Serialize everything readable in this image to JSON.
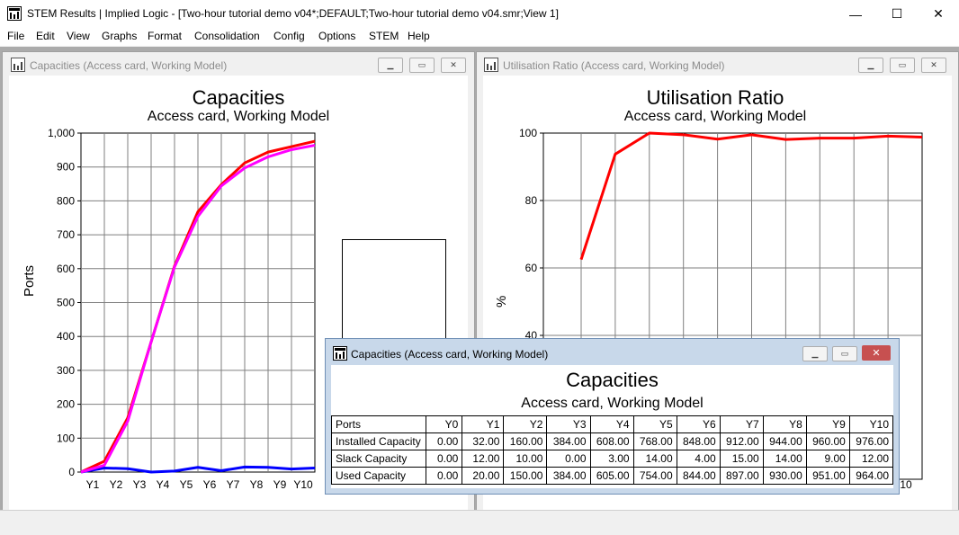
{
  "app": {
    "title": "STEM Results | Implied Logic - [Two-hour tutorial demo v04*;DEFAULT;Two-hour tutorial demo v04.smr;View 1]",
    "minimize": "—",
    "maximize": "☐",
    "close": "✕"
  },
  "menu": [
    "File",
    "Edit",
    "View",
    "Graphs",
    "Format",
    "Consolidation",
    "Config",
    "Options",
    "STEM",
    "Help"
  ],
  "left_window": {
    "title": "Capacities (Access card, Working Model)"
  },
  "right_window": {
    "title": "Utilisation Ratio (Access card, Working Model)"
  },
  "table_window": {
    "title": "Capacities (Access card, Working Model)",
    "heading": "Capacities",
    "subheading": "Access card, Working Model",
    "columns": [
      "Ports",
      "Y0",
      "Y1",
      "Y2",
      "Y3",
      "Y4",
      "Y5",
      "Y6",
      "Y7",
      "Y8",
      "Y9",
      "Y10"
    ],
    "rows": [
      {
        "label": "Installed Capacity",
        "values": [
          "0.00",
          "32.00",
          "160.00",
          "384.00",
          "608.00",
          "768.00",
          "848.00",
          "912.00",
          "944.00",
          "960.00",
          "976.00"
        ]
      },
      {
        "label": "Slack Capacity",
        "values": [
          "0.00",
          "12.00",
          "10.00",
          "0.00",
          "3.00",
          "14.00",
          "4.00",
          "15.00",
          "14.00",
          "9.00",
          "12.00"
        ]
      },
      {
        "label": "Used Capacity",
        "values": [
          "0.00",
          "20.00",
          "150.00",
          "384.00",
          "605.00",
          "754.00",
          "844.00",
          "897.00",
          "930.00",
          "951.00",
          "964.00"
        ]
      }
    ]
  },
  "chart_data": [
    {
      "type": "line",
      "title": "Capacities",
      "subtitle": "Access card, Working Model",
      "ylabel": "Ports",
      "xlabel": "",
      "ylim": [
        0,
        1000
      ],
      "yticks": [
        "0",
        "100",
        "200",
        "300",
        "400",
        "500",
        "600",
        "700",
        "800",
        "900",
        "1,000"
      ],
      "categories": [
        "Y0",
        "Y1",
        "Y2",
        "Y3",
        "Y4",
        "Y5",
        "Y6",
        "Y7",
        "Y8",
        "Y9",
        "Y10"
      ],
      "xtick_labels": [
        "Y1",
        "Y2",
        "Y3",
        "Y4",
        "Y5",
        "Y6",
        "Y7",
        "Y8",
        "Y9",
        "Y10"
      ],
      "grid": true,
      "legend_placement": "right",
      "series": [
        {
          "name": "Installed Capacity",
          "color": "#ff0000",
          "values": [
            0,
            32,
            160,
            384,
            608,
            768,
            848,
            912,
            944,
            960,
            976
          ]
        },
        {
          "name": "Slack Capacity",
          "color": "#0000ff",
          "values": [
            0,
            12,
            10,
            0,
            3,
            14,
            4,
            15,
            14,
            9,
            12
          ]
        },
        {
          "name": "Used Capacity",
          "color": "#ff00ff",
          "values": [
            0,
            20,
            150,
            384,
            605,
            754,
            844,
            897,
            930,
            951,
            964
          ]
        }
      ],
      "legend_lines": [
        [
          "Installed",
          "Capacity"
        ],
        [
          "Slack",
          "Capacity"
        ],
        [
          "Used",
          "Capacity"
        ]
      ]
    },
    {
      "type": "line",
      "title": "Utilisation Ratio",
      "subtitle": "Access card, Working Model",
      "ylabel": "%",
      "xlabel": "",
      "ylim_visible": [
        40,
        100
      ],
      "yticks": [
        "40",
        "60",
        "80",
        "100"
      ],
      "xtick_labels": [
        "10"
      ],
      "grid": true,
      "series": [
        {
          "name": "",
          "color": "#ff0000",
          "values": [
            62.5,
            93.75,
            100,
            99.5,
            98.2,
            99.5,
            98.1,
            98.5,
            98.5,
            99.1,
            98.8
          ]
        }
      ]
    }
  ]
}
